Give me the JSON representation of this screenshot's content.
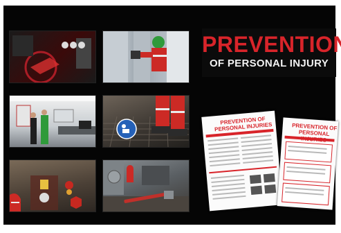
{
  "headline": {
    "line1": "PREVENTION",
    "line2": "OF PERSONAL INJURY"
  },
  "documents": [
    {
      "title": "PREVENTION OF PERSONAL INJURIES"
    },
    {
      "title": "PREVENTION OF PERSONAL INJURIES"
    }
  ],
  "colors": {
    "accent_red": "#d8242a",
    "background": "#050505",
    "headline_text": "#f2f2f2"
  }
}
